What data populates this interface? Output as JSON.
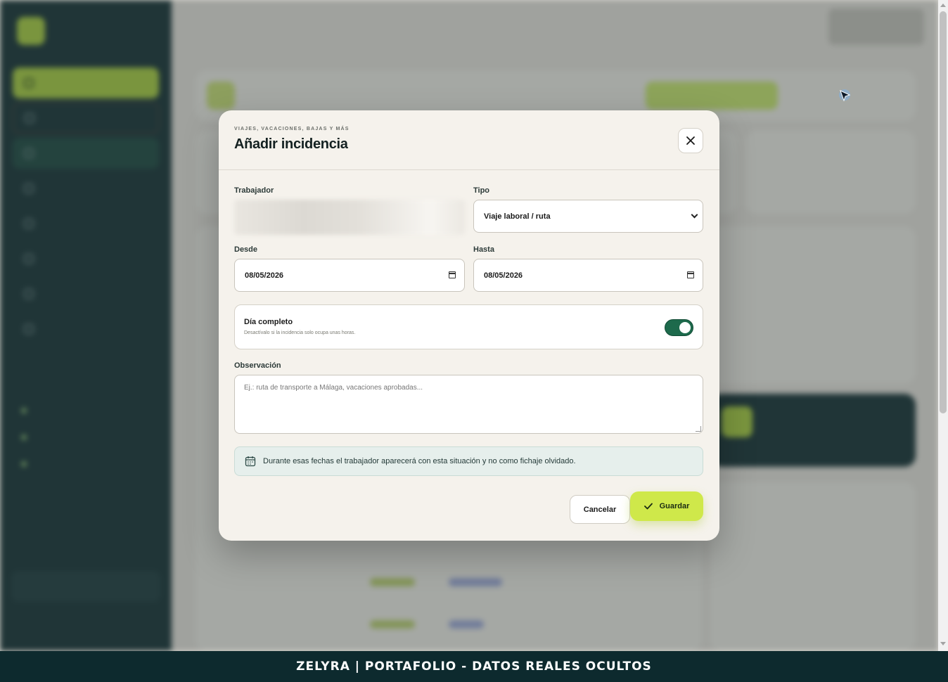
{
  "footer": {
    "text": "ZELYRA | PORTAFOLIO - DATOS REALES OCULTOS"
  },
  "modal": {
    "eyebrow": "VIAJES, VACACIONES, BAJAS Y MÁS",
    "title": "Añadir incidencia",
    "close_icon": "close-icon",
    "worker": {
      "label": "Trabajador"
    },
    "type": {
      "label": "Tipo",
      "value": "Viaje laboral / ruta"
    },
    "from": {
      "label": "Desde",
      "value": "08/05/2026"
    },
    "to": {
      "label": "Hasta",
      "value": "08/05/2026"
    },
    "full_day": {
      "title": "Día completo",
      "hint": "Desactívalo si la incidencia solo ocupa unas horas.",
      "enabled": true
    },
    "observation": {
      "label": "Observación",
      "placeholder": "Ej.: ruta de transporte a Málaga, vacaciones aprobadas..."
    },
    "info": {
      "icon": "calendar-icon",
      "text": "Durante esas fechas el trabajador aparecerá con esta situación y no como fichaje olvidado."
    },
    "cancel_label": "Cancelar",
    "save_label": "Guardar",
    "save_icon": "check-icon"
  },
  "colors": {
    "sidebar": "#0d2a2e",
    "accent": "#cfe84a",
    "toggle_on": "#1d6a4c",
    "modal_bg": "#f5f2ec"
  }
}
